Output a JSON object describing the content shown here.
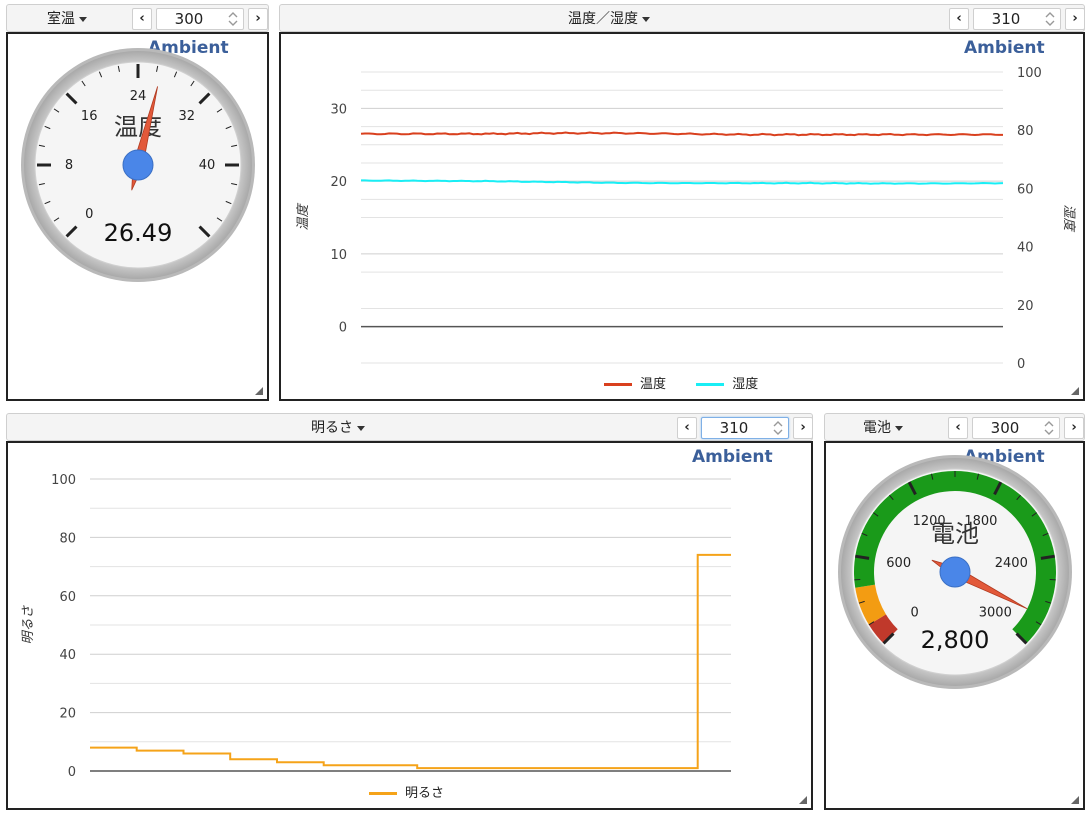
{
  "brand": "Ambient",
  "panels": {
    "room_temp": {
      "title": "室温",
      "count": "300"
    },
    "temp_humid": {
      "title": "温度／湿度",
      "count": "310"
    },
    "brightness": {
      "title": "明るさ",
      "count": "310"
    },
    "battery": {
      "title": "電池",
      "count": "300"
    }
  },
  "pager": {
    "prev_icon": "chevron-left-icon",
    "next_icon": "chevron-right-icon",
    "spin_icon": "spinner-arrows-icon"
  },
  "gauge_temp": {
    "label": "温度",
    "value_text": "26.49",
    "value": 26.49,
    "min": 0,
    "max": 48,
    "tick_labels": [
      "0",
      "8",
      "16",
      "24",
      "32",
      "40"
    ]
  },
  "gauge_battery": {
    "label": "電池",
    "value_text": "2,800",
    "value": 2800,
    "min": 0,
    "max": 3000,
    "tick_labels": [
      "0",
      "600",
      "1200",
      "1800",
      "2400",
      "3000"
    ]
  },
  "colors": {
    "temperature": "#d9401e",
    "humidity": "#19eef5",
    "brightness": "#f5a319",
    "gauge_needle": "#e2593a",
    "gauge_hub": "#4a86e8",
    "battery_green": "#1a9a1a",
    "battery_orange": "#f39c12",
    "battery_red": "#c0392b"
  },
  "chart_data": [
    {
      "type": "line",
      "title": "",
      "ylabel": "温度",
      "y2label": "湿度",
      "ylim": [
        -5,
        35
      ],
      "y2lim": [
        0,
        100
      ],
      "yticks": [
        "0",
        "10",
        "20",
        "30"
      ],
      "y2ticks": [
        "0",
        "20",
        "40",
        "60",
        "80",
        "100"
      ],
      "grid": true,
      "legend": "bottom",
      "series": [
        {
          "name": "温度",
          "axis": "left",
          "values": [
            26.5,
            26.5,
            26.5,
            26.6,
            26.6,
            26.5,
            26.4,
            26.4,
            26.4,
            26.4,
            26.4
          ]
        },
        {
          "name": "湿度",
          "axis": "right",
          "values": [
            62.7,
            62.6,
            62.5,
            62.2,
            61.9,
            61.8,
            61.8,
            61.8,
            61.7,
            61.7,
            61.8
          ]
        }
      ]
    },
    {
      "type": "line",
      "title": "",
      "ylabel": "明るさ",
      "ylim": [
        0,
        100
      ],
      "yticks": [
        "0",
        "20",
        "40",
        "60",
        "80",
        "100"
      ],
      "grid": true,
      "legend": "bottom",
      "series": [
        {
          "name": "明るさ",
          "values": [
            8,
            8,
            7,
            7,
            6,
            6,
            4,
            4,
            3,
            3,
            2,
            2,
            2,
            2,
            1,
            1,
            1,
            1,
            1,
            1,
            1,
            1,
            1,
            1,
            1,
            1,
            74,
            74
          ]
        }
      ]
    }
  ]
}
